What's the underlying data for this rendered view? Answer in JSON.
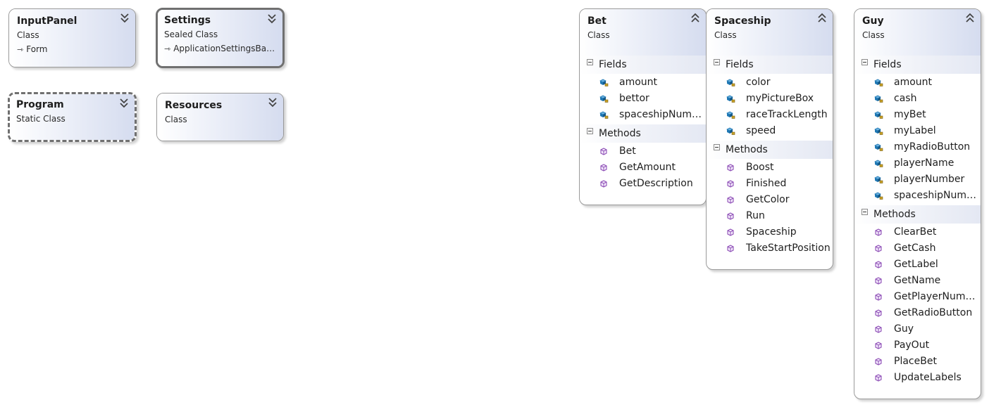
{
  "colors": {
    "header_gradient_end": "#d5dcef",
    "field_icon": "#1f78b4",
    "method_icon": "#8e4fb6",
    "border": "#9a9a9a"
  },
  "icons": {
    "collapse_expand": "double-chevron-icon",
    "field": "field-cube-icon",
    "private_field": "private-field-cube-lock-icon",
    "method": "method-cube-icon",
    "inheritance": "inheritance-arrow-icon"
  },
  "classes": {
    "inputpanel": {
      "name": "InputPanel",
      "kind": "Class",
      "base": "Form"
    },
    "settings": {
      "name": "Settings",
      "kind": "Sealed Class",
      "base": "ApplicationSettingsBa…"
    },
    "program": {
      "name": "Program",
      "kind": "Static Class"
    },
    "resources": {
      "name": "Resources",
      "kind": "Class"
    },
    "bet": {
      "name": "Bet",
      "kind": "Class",
      "fields_label": "Fields",
      "methods_label": "Methods",
      "fields": [
        "amount",
        "bettor",
        "spaceshipNum…"
      ],
      "methods": [
        "Bet",
        "GetAmount",
        "GetDescription"
      ]
    },
    "spaceship": {
      "name": "Spaceship",
      "kind": "Class",
      "fields_label": "Fields",
      "methods_label": "Methods",
      "fields": [
        "color",
        "myPictureBox",
        "raceTrackLength",
        "speed"
      ],
      "methods": [
        "Boost",
        "Finished",
        "GetColor",
        "Run",
        "Spaceship",
        "TakeStartPosition"
      ]
    },
    "guy": {
      "name": "Guy",
      "kind": "Class",
      "fields_label": "Fields",
      "methods_label": "Methods",
      "fields": [
        "amount",
        "cash",
        "myBet",
        "myLabel",
        "myRadioButton",
        "playerName",
        "playerNumber",
        "spaceshipNum…"
      ],
      "methods": [
        "ClearBet",
        "GetCash",
        "GetLabel",
        "GetName",
        "GetPlayerNum…",
        "GetRadioButton",
        "Guy",
        "PayOut",
        "PlaceBet",
        "UpdateLabels"
      ]
    }
  }
}
